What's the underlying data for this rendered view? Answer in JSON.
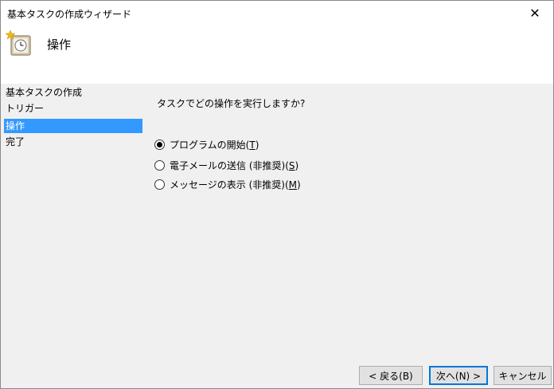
{
  "window": {
    "title": "基本タスクの作成ウィザード",
    "close_glyph": "✕"
  },
  "header": {
    "title": "操作",
    "icon": "task-clock-icon"
  },
  "nav": {
    "items": [
      {
        "label": "基本タスクの作成",
        "selected": false
      },
      {
        "label": "トリガー",
        "selected": false
      },
      {
        "label": "操作",
        "selected": true
      },
      {
        "label": "完了",
        "selected": false
      }
    ]
  },
  "main": {
    "question": "タスクでどの操作を実行しますか?",
    "options": [
      {
        "label": "プログラムの開始",
        "key_open": "(",
        "key": "T",
        "key_close": ")",
        "checked": true
      },
      {
        "label": "電子メールの送信 (非推奨)",
        "key_open": "(",
        "key": "S",
        "key_close": ")",
        "checked": false
      },
      {
        "label": "メッセージの表示 (非推奨)",
        "key_open": "(",
        "key": "M",
        "key_close": ")",
        "checked": false
      }
    ]
  },
  "buttons": {
    "back_label": "< 戻る(B)",
    "next_label": "次へ(N) >",
    "cancel_label": "キャンセル"
  },
  "colors": {
    "selection": "#3399ff",
    "default_button_border": "#0078d7"
  }
}
